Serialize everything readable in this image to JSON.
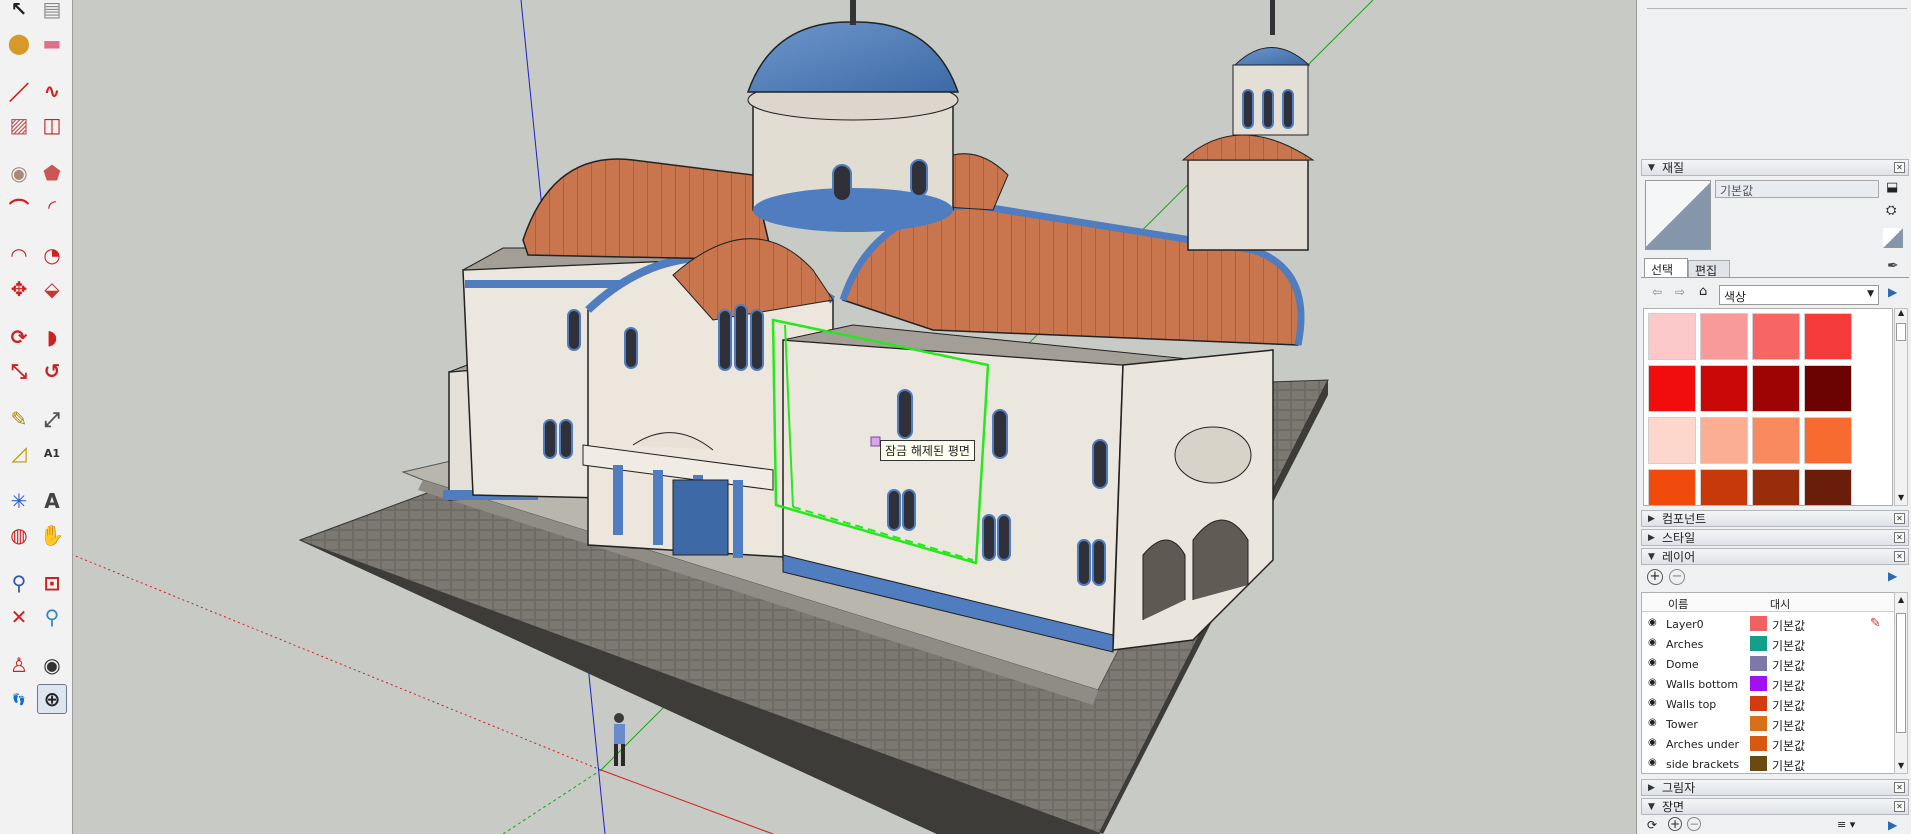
{
  "toolbar": {
    "tools": [
      {
        "name": "select-tool-icon",
        "glyph": "↖",
        "color": "#222"
      },
      {
        "name": "component-tool-icon",
        "glyph": "▤",
        "color": "#8a8a8a"
      },
      {
        "name": "paint-bucket-icon",
        "glyph": "⬤",
        "color": "#d79a2a"
      },
      {
        "name": "eraser-icon",
        "glyph": "▬",
        "color": "#e0708a"
      },
      {
        "name": "pencil-line-icon",
        "glyph": "／",
        "color": "#c22"
      },
      {
        "name": "freehand-icon",
        "glyph": "∿",
        "color": "#c22"
      },
      {
        "name": "rectangle-icon",
        "glyph": "▨",
        "color": "#b55"
      },
      {
        "name": "rotated-rectangle-icon",
        "glyph": "◫",
        "color": "#c22"
      },
      {
        "name": "circle-icon",
        "glyph": "◉",
        "color": "#a87"
      },
      {
        "name": "polygon-icon",
        "glyph": "⬟",
        "color": "#c55"
      },
      {
        "name": "arc-icon",
        "glyph": "⌒",
        "color": "#c22"
      },
      {
        "name": "two-point-arc-icon",
        "glyph": "◜",
        "color": "#c22"
      },
      {
        "name": "three-point-arc-icon",
        "glyph": "◠",
        "color": "#c22"
      },
      {
        "name": "pie-icon",
        "glyph": "◔",
        "color": "#c22"
      },
      {
        "name": "move-icon",
        "glyph": "✥",
        "color": "#c22"
      },
      {
        "name": "push-pull-icon",
        "glyph": "⬙",
        "color": "#c33"
      },
      {
        "name": "rotate-icon",
        "glyph": "⟳",
        "color": "#c22"
      },
      {
        "name": "follow-me-icon",
        "glyph": "◗",
        "color": "#c22"
      },
      {
        "name": "scale-icon",
        "glyph": "⤡",
        "color": "#c22"
      },
      {
        "name": "offset-icon",
        "glyph": "↺",
        "color": "#c22"
      },
      {
        "name": "tape-measure-icon",
        "glyph": "✎",
        "color": "#a80"
      },
      {
        "name": "dimension-icon",
        "glyph": "⤢",
        "color": "#555"
      },
      {
        "name": "protractor-icon",
        "glyph": "◿",
        "color": "#b90"
      },
      {
        "name": "text-tool-icon",
        "glyph": "A1",
        "color": "#333"
      },
      {
        "name": "axes-icon",
        "glyph": "✳",
        "color": "#25c"
      },
      {
        "name": "3d-text-icon",
        "glyph": "A",
        "color": "#444"
      },
      {
        "name": "orbit-icon",
        "glyph": "◍",
        "color": "#c22"
      },
      {
        "name": "pan-icon",
        "glyph": "✋",
        "color": "#d9a060"
      },
      {
        "name": "zoom-icon",
        "glyph": "⚲",
        "color": "#35a"
      },
      {
        "name": "zoom-window-icon",
        "glyph": "⊡",
        "color": "#c22"
      },
      {
        "name": "zoom-extents-icon",
        "glyph": "✕",
        "color": "#c22"
      },
      {
        "name": "previous-view-icon",
        "glyph": "⚲",
        "color": "#38b"
      },
      {
        "name": "position-camera-icon",
        "glyph": "♙",
        "color": "#c22"
      },
      {
        "name": "look-around-icon",
        "glyph": "◉",
        "color": "#333"
      },
      {
        "name": "walk-icon",
        "glyph": "👣",
        "color": "#222"
      },
      {
        "name": "section-plane-icon",
        "glyph": "⊕",
        "color": "#222"
      }
    ]
  },
  "viewport": {
    "tooltip": "잠금 해제된 평면"
  },
  "materials": {
    "title": "재질",
    "name_value": "기본값",
    "tab_select": "선택",
    "tab_edit": "편집",
    "library": "색상",
    "swatches": [
      "#fbc9c9",
      "#f99a9a",
      "#f86565",
      "#f53a3a",
      "#f10d0d",
      "#cb0808",
      "#9e0404",
      "#6a0202",
      "#fdd6cc",
      "#fbae94",
      "#f98a5e",
      "#f76a30",
      "#f04a0c",
      "#c7380b",
      "#982c0b",
      "#6a1d08"
    ]
  },
  "collapsed_sections": {
    "components": "컴포넌트",
    "styles": "스타일"
  },
  "layers": {
    "title": "레이어",
    "col_name": "이름",
    "col_dash": "대시",
    "rows": [
      {
        "name": "Layer0",
        "color": "#f06161",
        "dash": "기본값"
      },
      {
        "name": "Arches",
        "color": "#13a08a",
        "dash": "기본값"
      },
      {
        "name": "Dome",
        "color": "#7d78a8",
        "dash": "기본값"
      },
      {
        "name": "Walls bottom",
        "color": "#a010f0",
        "dash": "기본값"
      },
      {
        "name": "Walls top",
        "color": "#d23c0f",
        "dash": "기본값"
      },
      {
        "name": "Tower",
        "color": "#d8701a",
        "dash": "기본값"
      },
      {
        "name": "Arches under",
        "color": "#d85a12",
        "dash": "기본값"
      },
      {
        "name": "side brackets",
        "color": "#6a4a10",
        "dash": "기본값"
      }
    ]
  },
  "shadows": {
    "title": "그림자"
  },
  "scenes": {
    "title": "장면"
  }
}
